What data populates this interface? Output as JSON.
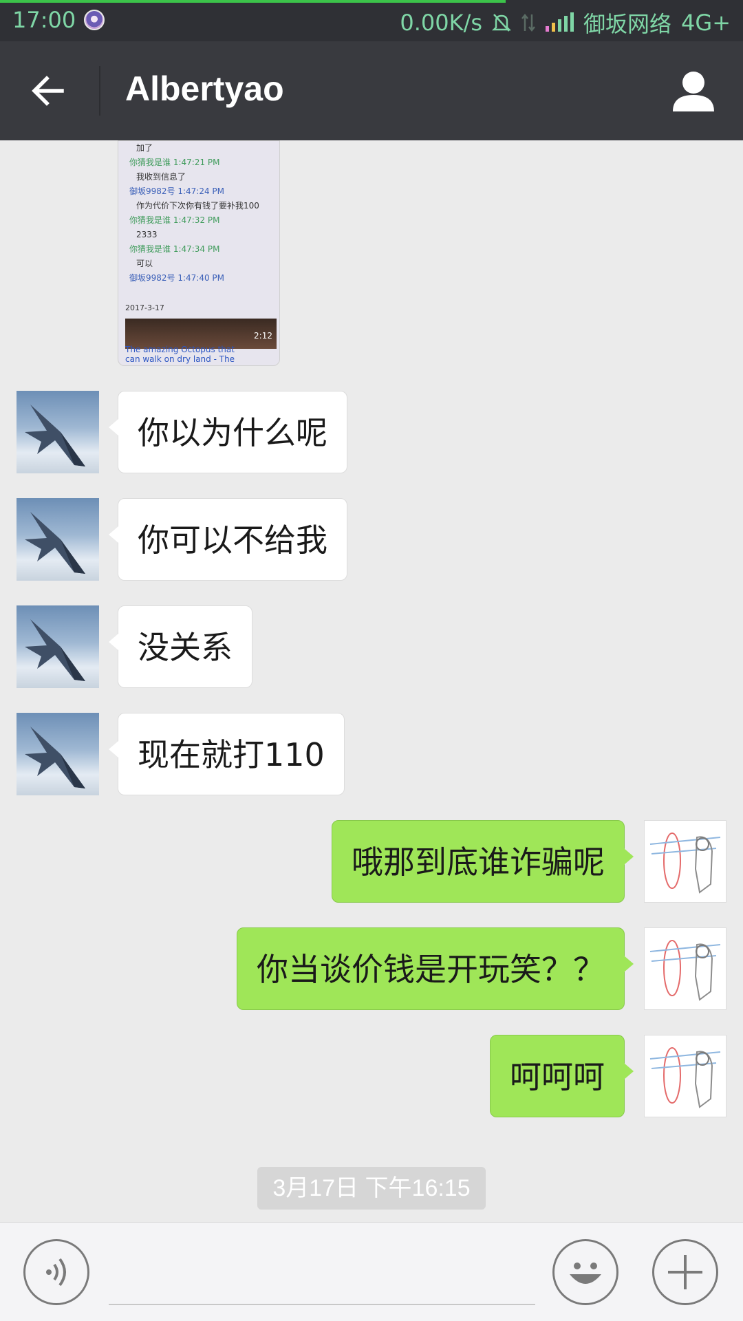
{
  "status_bar": {
    "time": "17:00",
    "speed": "0.00K/s",
    "carrier": "御坂网络",
    "network": "4G+"
  },
  "header": {
    "title": "Albertyao",
    "back_icon": "back-arrow-icon",
    "profile_icon": "person-icon"
  },
  "image_message": {
    "lines": [
      {
        "text": "加了",
        "style": "dark"
      },
      {
        "text": "你猜我是谁 1:47:21 PM",
        "style": "green"
      },
      {
        "text": "我收到信息了",
        "style": "dark"
      },
      {
        "text": "御坂9982号 1:47:24 PM",
        "style": "blue"
      },
      {
        "text": "作为代价下次你有钱了要补我100",
        "style": "dark"
      },
      {
        "text": "你猜我是谁 1:47:32 PM",
        "style": "green"
      },
      {
        "text": "2333",
        "style": "dark"
      },
      {
        "text": "你猜我是谁 1:47:34 PM",
        "style": "green"
      },
      {
        "text": "可以",
        "style": "dark"
      },
      {
        "text": "御坂9982号 1:47:40 PM",
        "style": "blue"
      }
    ],
    "date": "2017-3-17",
    "video_duration": "2:12",
    "video_caption": "The amazing Octopus that can walk on dry land - The"
  },
  "messages": [
    {
      "side": "left",
      "text": "你以为什么呢"
    },
    {
      "side": "left",
      "text": "你可以不给我"
    },
    {
      "side": "left",
      "text": "没关系"
    },
    {
      "side": "left",
      "text": "现在就打110"
    },
    {
      "side": "right",
      "text": "哦那到底谁诈骗呢"
    },
    {
      "side": "right",
      "text": "你当谈价钱是开玩笑？？"
    },
    {
      "side": "right",
      "text": "呵呵呵"
    }
  ],
  "timestamp": "3月17日 下午16:15",
  "input_bar": {
    "voice_icon": "voice-icon",
    "emoji_icon": "emoji-icon",
    "plus_icon": "plus-icon"
  },
  "colors": {
    "title_bar": "#393a3f",
    "status_bar": "#2f3035",
    "background": "#ebebeb",
    "sent_bubble": "#9fe658",
    "received_bubble": "#ffffff"
  }
}
